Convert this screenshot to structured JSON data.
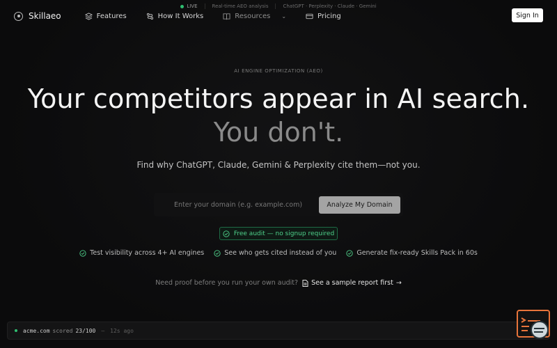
{
  "live_strip": {
    "live_label": "LIVE",
    "analysis_label": "Real-time AEO analysis",
    "engines": "ChatGPT · Perplexity · Claude · Gemini"
  },
  "nav": {
    "brand": "Skillaeo",
    "items": [
      {
        "label": "Features",
        "icon": "layers-icon"
      },
      {
        "label": "How It Works",
        "icon": "workflow-icon"
      },
      {
        "label": "Resources",
        "icon": "book-icon"
      },
      {
        "label": "Pricing",
        "icon": "card-icon"
      }
    ],
    "signin": "Sign In"
  },
  "hero": {
    "eyebrow": "AI ENGINE OPTIMIZATION (AEO)",
    "headline": "Your competitors appear in AI search.",
    "headline_2": "You don't.",
    "subhead": "Find why ChatGPT, Claude, Gemini & Perplexity cite them—not you."
  },
  "form": {
    "placeholder": "Enter your domain (e.g. example.com)",
    "button": "Analyze My Domain"
  },
  "badge": "Free audit — no signup required",
  "features": [
    "Test visibility across 4+ AI engines",
    "See who gets cited instead of you",
    "Generate fix-ready Skills Pack in 60s"
  ],
  "proof": {
    "question": "Need proof before you run your own audit?",
    "link": "See a sample report first"
  },
  "toast": {
    "domain": "acme.com",
    "scored": "scored",
    "score": "23/100",
    "dash": "—",
    "time": "12s ago"
  },
  "colors": {
    "accent_green": "#2fbf71",
    "background": "#0c0c0d",
    "chat_widget": "#e8743b"
  }
}
